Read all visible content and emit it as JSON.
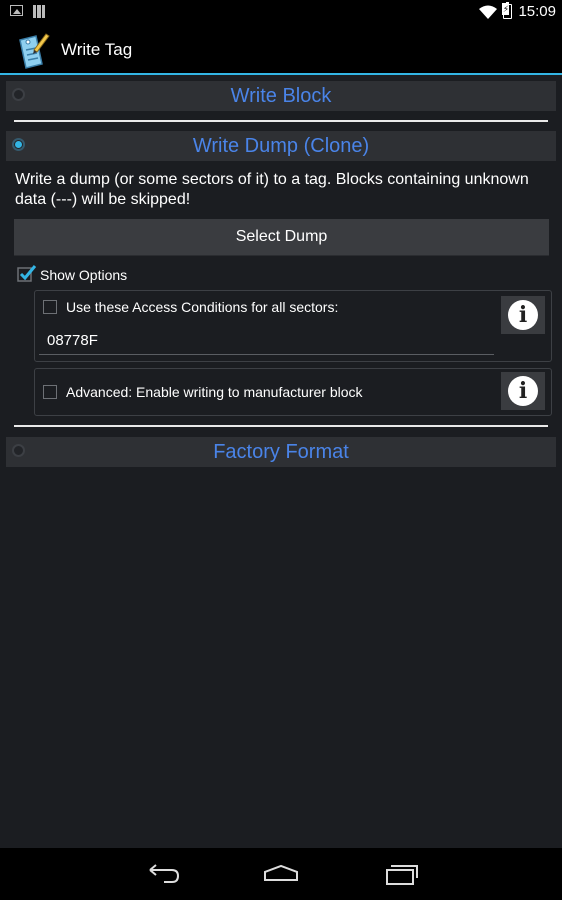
{
  "status_bar": {
    "time": "15:09",
    "icons": [
      "image-notification-icon",
      "barcode-notification-icon",
      "wifi-icon",
      "battery-charging-icon"
    ]
  },
  "action_bar": {
    "title": "Write Tag",
    "app_icon": "tag-pencil-icon"
  },
  "sections": {
    "write_block": {
      "label": "Write Block",
      "selected": false
    },
    "write_dump": {
      "label": "Write Dump (Clone)",
      "selected": true,
      "description": "Write a dump (or some sectors of it) to a tag. Blocks containing unknown data (---) will be skipped!",
      "select_button": "Select Dump",
      "show_options": {
        "label": "Show Options",
        "checked": true
      },
      "access_conditions": {
        "label": "Use these Access Conditions for all sectors:",
        "checked": false,
        "value": "08778F"
      },
      "advanced": {
        "label": "Advanced: Enable writing to manufacturer block",
        "checked": false
      }
    },
    "factory_format": {
      "label": "Factory Format",
      "selected": false
    }
  },
  "colors": {
    "accent": "#33b5e5",
    "header_text": "#4a84e8",
    "background": "#1b1d21"
  },
  "nav_bar": {
    "buttons": [
      "back-icon",
      "home-icon",
      "recent-apps-icon"
    ]
  }
}
